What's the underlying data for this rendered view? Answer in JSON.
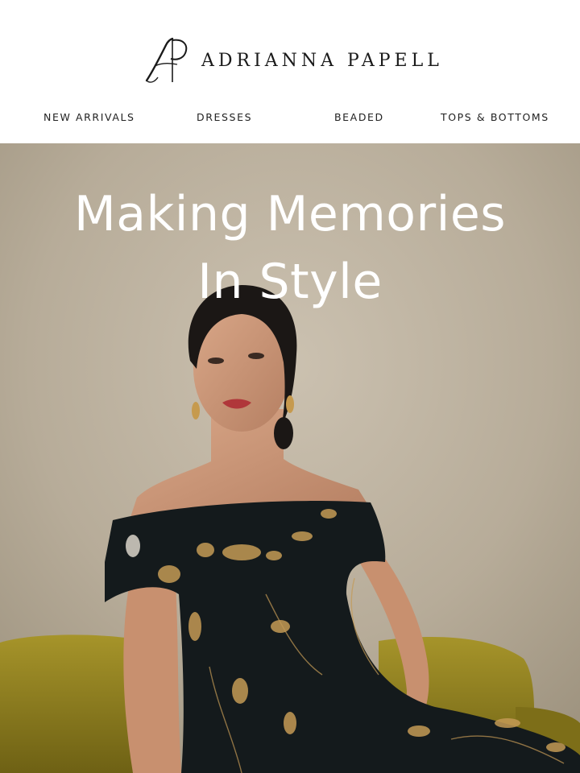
{
  "brand": {
    "name": "ADRIANNA PAPELL",
    "logo_icon": "ap-monogram-logo"
  },
  "nav": {
    "items": [
      {
        "label": "NEW ARRIVALS"
      },
      {
        "label": "DRESSES"
      },
      {
        "label": "BEADED"
      },
      {
        "label": "TOPS & BOTTOMS"
      }
    ]
  },
  "hero": {
    "heading_line1": "Making Memories",
    "heading_line2": "In Style",
    "image": "woman-in-black-floral-off-shoulder-gown-on-olive-velvet-sofa"
  },
  "colors": {
    "hero_text": "#ffffff",
    "nav_text": "#222222",
    "backdrop": "#b9ae9b",
    "sofa": "#8f7f1e",
    "gown": "#151a1c",
    "gown_print": "#c49a55"
  }
}
